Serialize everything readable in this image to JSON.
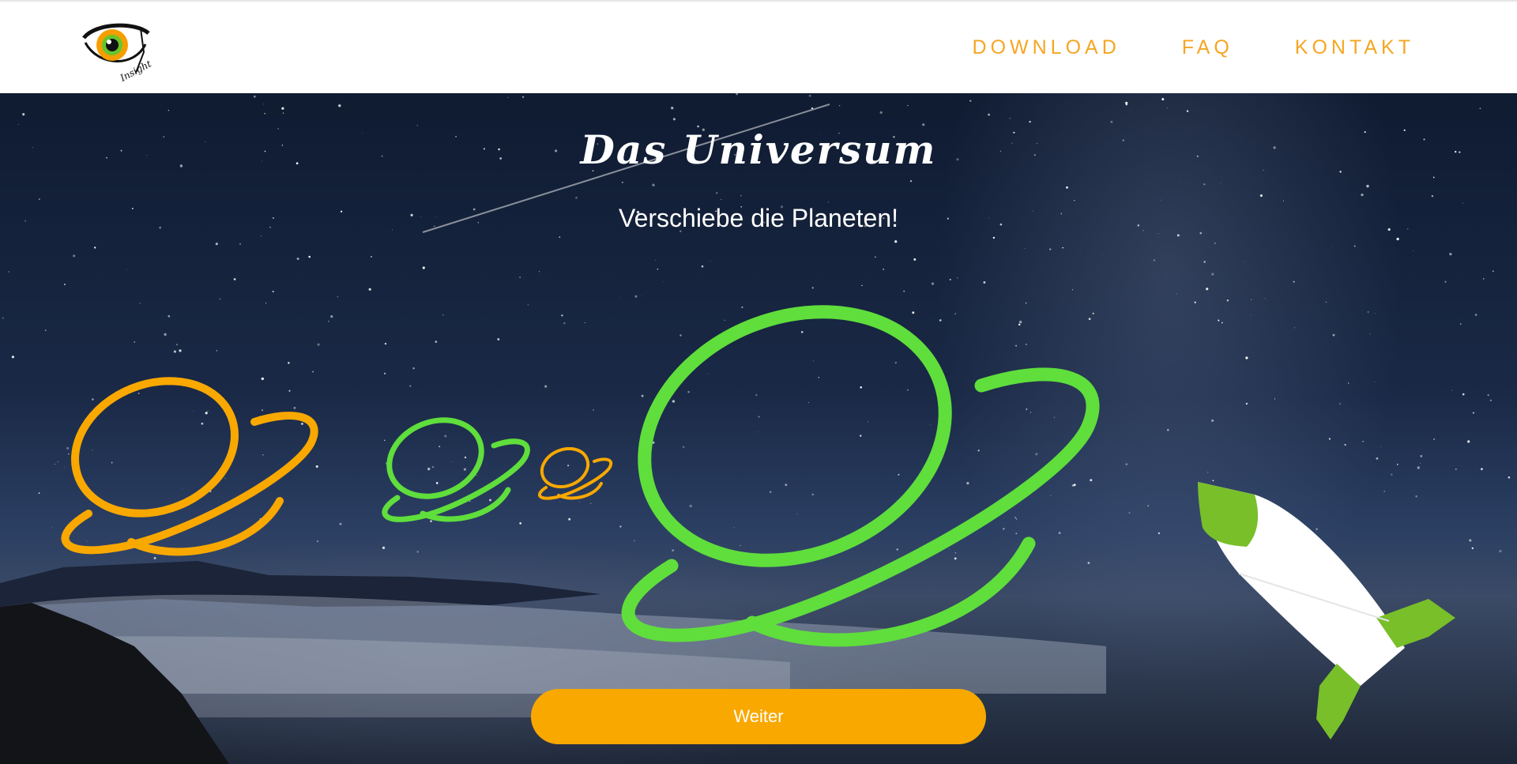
{
  "nav": {
    "logo_label": "Insight",
    "items": [
      {
        "label": "DOWNLOAD"
      },
      {
        "label": "FAQ"
      },
      {
        "label": "KONTAKT"
      }
    ]
  },
  "hero": {
    "title": "Das Universum",
    "subtitle": "Verschiebe die Planeten!",
    "button_label": "Weiter"
  },
  "colors": {
    "accent_orange": "#f9a800",
    "nav_orange": "#f5a623",
    "planet_green": "#5fde3c",
    "rocket_green": "#78bf2a"
  },
  "icons": [
    "eye-logo-icon",
    "planet-icon",
    "rocket-icon"
  ]
}
